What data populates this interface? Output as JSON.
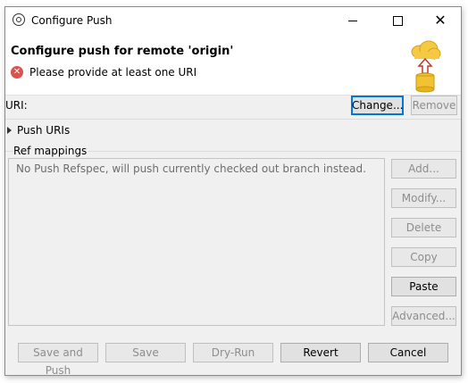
{
  "window": {
    "title": "Configure Push",
    "controls": [
      "minimize-icon",
      "maximize-icon",
      "close-icon"
    ]
  },
  "header": {
    "title": "Configure push for remote 'origin'",
    "error_message": "Please provide at least one URI",
    "error_icon_glyph": "✕",
    "banner_icon": "cloud-push-icon"
  },
  "uri": {
    "label": "URI:",
    "change_label": "Change...",
    "remove_label": "Remove"
  },
  "push_uris": {
    "label": "Push URIs"
  },
  "ref_mappings": {
    "label": "Ref mappings",
    "empty_text": "No Push Refspec, will push currently checked out branch instead.",
    "buttons": {
      "add": "Add...",
      "modify": "Modify...",
      "delete": "Delete",
      "copy": "Copy",
      "paste": "Paste",
      "advanced": "Advanced..."
    }
  },
  "footer": {
    "save_and_push": "Save and Push",
    "save": "Save",
    "dry_run": "Dry-Run",
    "revert": "Revert",
    "cancel": "Cancel"
  },
  "colors": {
    "dialog_bg": "#f0f0f0",
    "error": "#d9534f",
    "focus": "#0078d7",
    "disabled_text": "#8d8d8d"
  }
}
